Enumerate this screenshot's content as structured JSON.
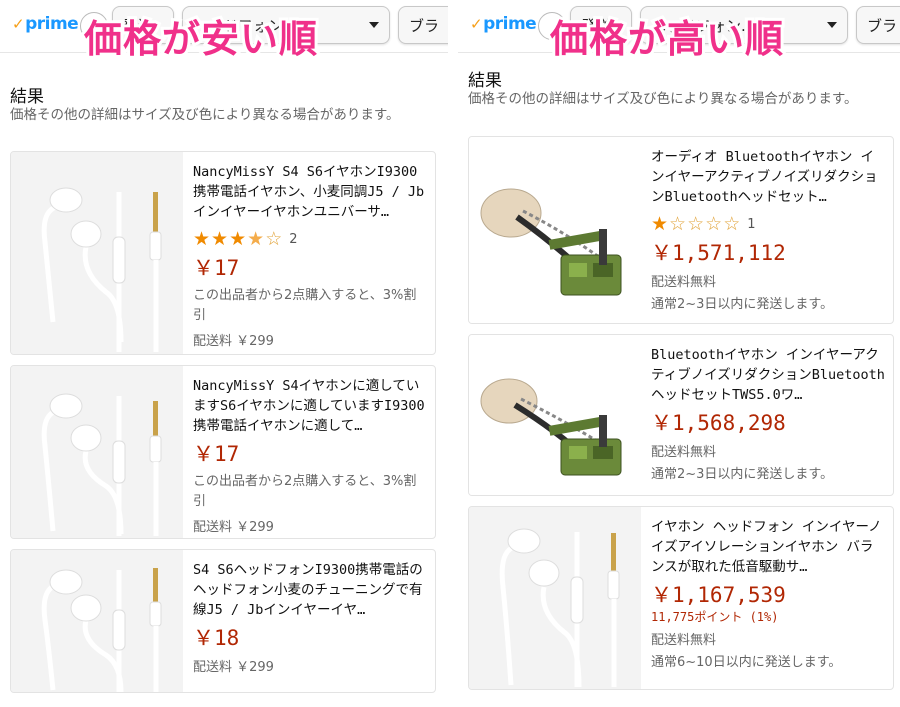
{
  "left": {
    "overlay_title": "価格が安い順",
    "prime_label": "prime",
    "filters": [
      "発送",
      "ヘッドフォン...",
      "ブラ"
    ],
    "results_heading": "結果",
    "results_note": "価格その他の詳細はサイズ及び色により異なる場合があります。",
    "products": [
      {
        "title": "NancyMissY S4 S6イヤホンI9300携帯電話イヤホン、小麦同調J5 / Jbインイヤーイヤホンユニバーサ…",
        "rating_count": "2",
        "price": "￥17",
        "note": "この出品者から2点購入すると、3%割引",
        "shipping": "配送料 ￥299"
      },
      {
        "title": "NancyMissY S4イヤホンに適していますS6イヤホンに適していますI9300携帯電話イヤホンに適して…",
        "price": "￥17",
        "note": "この出品者から2点購入すると、3%割引",
        "shipping": "配送料 ￥299"
      },
      {
        "title": "S4 S6ヘッドフォンI9300携帯電話のヘッドフォン小麦のチューニングで有線J5 / Jbインイヤーイヤ…",
        "price": "￥18",
        "shipping": "配送料 ￥299"
      }
    ]
  },
  "right": {
    "overlay_title": "価格が高い順",
    "prime_label": "prime",
    "filters": [
      "発送",
      "ヘッドフォン...",
      "ブラ"
    ],
    "results_heading": "結果",
    "results_note": "価格その他の詳細はサイズ及び色により異なる場合があります。",
    "products": [
      {
        "title": "オーディオ Bluetoothイヤホン インイヤーアクティブノイズリダクションBluetoothヘッドセット…",
        "rating_count": "1",
        "price": "￥1,571,112",
        "shipping": "配送料無料",
        "delivery": "通常2~3日以内に発送します。"
      },
      {
        "title": "Bluetoothイヤホン インイヤーアクティブノイズリダクションBluetoothヘッドセットTWS5.0ワ…",
        "price": "￥1,568,298",
        "shipping": "配送料無料",
        "delivery": "通常2~3日以内に発送します。"
      },
      {
        "title": "イヤホン ヘッドフォン インイヤーノイズアイソレーションイヤホン バランスが取れた低音駆動サ…",
        "price": "￥1,167,539",
        "points": "11,775ポイント (1%)",
        "shipping": "配送料無料",
        "delivery": "通常6~10日以内に発送します。"
      }
    ]
  },
  "ratings": {
    "left_first_stars": 3.5,
    "right_first_stars": 1
  },
  "colors": {
    "overlay": "#f0308a",
    "price": "#b12704",
    "star": "#f08a00",
    "prime": "#1a98ff"
  }
}
